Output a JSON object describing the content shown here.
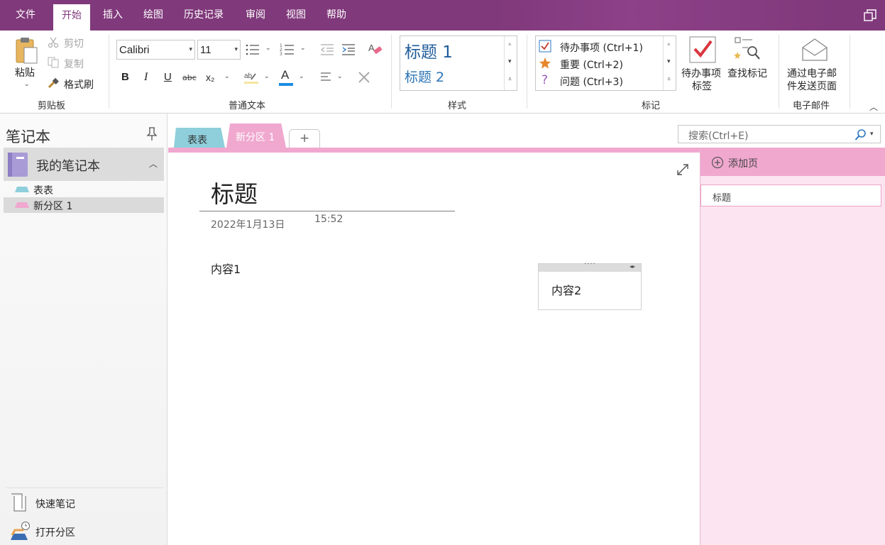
{
  "menu": {
    "items": [
      "文件",
      "开始",
      "插入",
      "绘图",
      "历史记录",
      "审阅",
      "视图",
      "帮助"
    ],
    "active_index": 1
  },
  "ribbon": {
    "clipboard": {
      "paste": "粘贴",
      "cut": "剪切",
      "copy": "复制",
      "format_painter": "格式刷",
      "group_label": "剪贴板"
    },
    "basic_text": {
      "font": "Calibri",
      "size": "11",
      "bold": "B",
      "italic": "I",
      "underline": "U",
      "strike": "abc",
      "subscript": "x₂",
      "font_color_letter": "A",
      "group_label": "普通文本"
    },
    "styles": {
      "heading1": "标题 1",
      "heading2": "标题 2",
      "group_label": "样式"
    },
    "tags": {
      "todo": "待办事项 (Ctrl+1)",
      "important": "重要 (Ctrl+2)",
      "question": "问题 (Ctrl+3)",
      "todo_tag_line1": "待办事项",
      "todo_tag_line2": "标签",
      "find_tags": "查找标记",
      "group_label": "标记"
    },
    "email": {
      "line1": "通过电子邮",
      "line2": "件发送页面",
      "group_label": "电子邮件"
    }
  },
  "notebook_pane": {
    "title": "笔记本",
    "notebook_name": "我的笔记本",
    "sections": [
      {
        "name": "表表",
        "color": "#8ecfdb"
      },
      {
        "name": "新分区 1",
        "color": "#f0a8cf"
      }
    ],
    "quick_notes": "快速笔记",
    "open_sections": "打开分区"
  },
  "tabs": {
    "items": [
      {
        "label": "表表",
        "color": "#8ecfdb"
      },
      {
        "label": "新分区 1",
        "color": "#f0a8cf"
      }
    ],
    "add": "+"
  },
  "search": {
    "placeholder": "搜索(Ctrl+E)"
  },
  "page": {
    "title": "标题",
    "date": "2022年1月13日",
    "time": "15:52",
    "content1": "内容1",
    "content2": "内容2"
  },
  "pages_pane": {
    "add_page": "添加页",
    "pages": [
      "标题"
    ]
  },
  "colors": {
    "accent": "#80397b",
    "section_pink": "#f0a8cf",
    "section_blue": "#8ecfdb",
    "pane_pink": "#fde4f1"
  }
}
